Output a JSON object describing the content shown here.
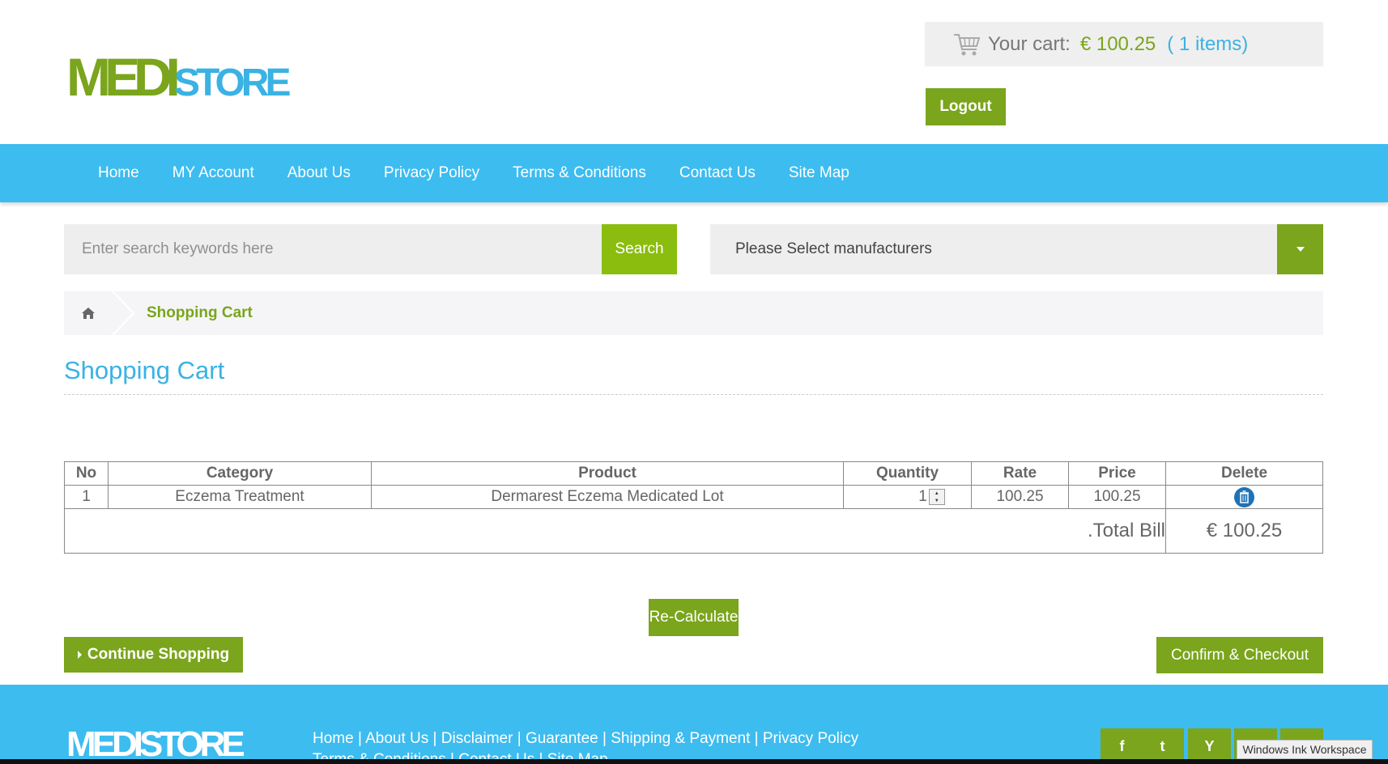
{
  "header": {
    "logo_medi": "MEDI",
    "logo_store": "STORE",
    "cart_label": "Your cart:",
    "cart_amount": "€ 100.25",
    "cart_items": "( 1 items)",
    "logout_label": "Logout"
  },
  "nav": {
    "items": [
      "Home",
      "MY Account",
      "About Us",
      "Privacy Policy",
      "Terms & Conditions",
      "Contact Us",
      "Site Map"
    ]
  },
  "search": {
    "placeholder": "Enter search keywords here",
    "button_label": "Search",
    "manufacturers_label": "Please Select manufacturers"
  },
  "breadcrumb": {
    "current": "Shopping Cart"
  },
  "page_title": "Shopping Cart",
  "table": {
    "headers": [
      "No",
      "Category",
      "Product",
      "Quantity",
      "Rate",
      "Price",
      "Delete"
    ],
    "rows": [
      {
        "no": "1",
        "category": "Eczema Treatment",
        "product": "Dermarest Eczema Medicated Lot",
        "quantity": "1",
        "rate": "100.25",
        "price": "100.25"
      }
    ],
    "total_label": ".Total Bill",
    "total_value": "€ 100.25"
  },
  "actions": {
    "recalculate": "Re-Calculate",
    "continue": "Continue Shopping",
    "checkout": "Confirm & Checkout"
  },
  "footer": {
    "logo": "MEDISTORE",
    "links_line1": "Home | About Us | Disclaimer | Guarantee | Shipping & Payment | Privacy Policy",
    "links_line2": "Terms & Conditions | Contact Us | Site Map",
    "social": [
      "f",
      "t",
      "Y",
      "m",
      "in"
    ]
  },
  "system": {
    "ink_workspace": "Windows Ink Workspace"
  },
  "colors": {
    "brand_green": "#7aa51c",
    "brand_blue": "#3dbcf0",
    "search_green": "#8bbd0e"
  }
}
